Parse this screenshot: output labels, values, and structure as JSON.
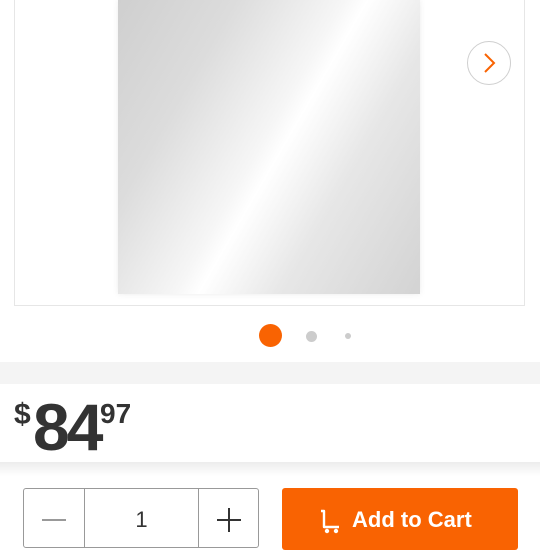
{
  "product": {
    "gallery": {
      "next_icon": "chevron-right-icon",
      "image_count": 3,
      "active_index": 0
    },
    "price": {
      "currency": "$",
      "dollars": "84",
      "cents": "97"
    }
  },
  "purchase": {
    "quantity": "1",
    "minus_icon": "minus-icon",
    "plus_icon": "plus-icon",
    "add_to_cart_label": "Add to Cart",
    "cart_icon": "cart-icon"
  },
  "colors": {
    "accent": "#f96302",
    "text": "#333333",
    "inactive_dot": "#cccccc"
  }
}
